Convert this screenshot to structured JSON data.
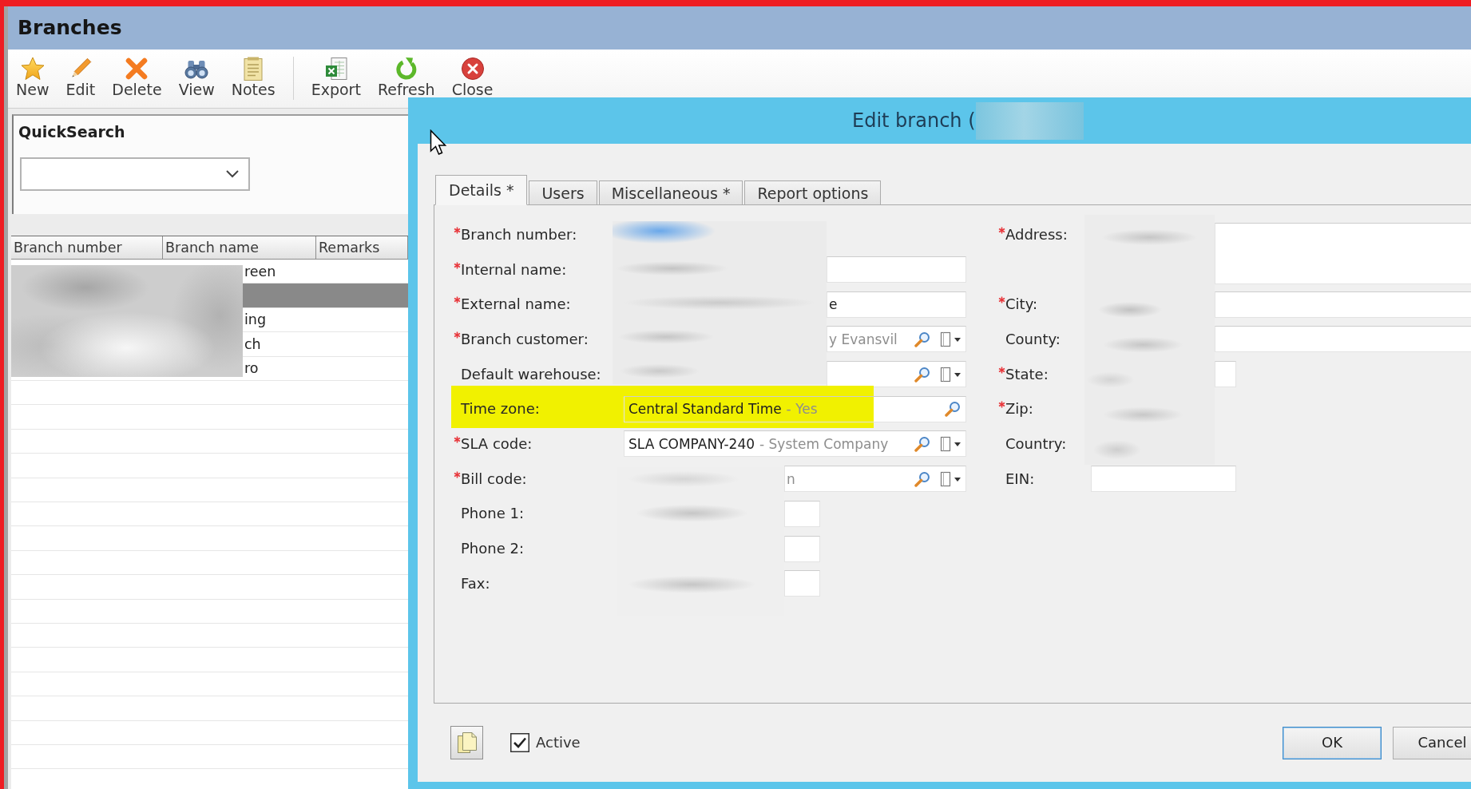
{
  "window": {
    "title": "Branches"
  },
  "toolbar": {
    "groups": [
      {
        "items": [
          {
            "label": "New"
          },
          {
            "label": "Edit"
          },
          {
            "label": "Delete"
          },
          {
            "label": "View"
          },
          {
            "label": "Notes"
          }
        ]
      },
      {
        "items": [
          {
            "label": "Export"
          },
          {
            "label": "Refresh"
          },
          {
            "label": "Close"
          }
        ]
      }
    ]
  },
  "quick_search": {
    "title": "QuickSearch"
  },
  "branch_list": {
    "columns": [
      "Branch number",
      "Branch name",
      "Remarks"
    ],
    "rows": [
      {
        "selected": false,
        "branch_name": "reen"
      },
      {
        "selected": true
      },
      {
        "selected": false,
        "branch_name": "ing"
      },
      {
        "selected": false,
        "branch_name": "ch"
      },
      {
        "selected": false,
        "branch_name": "ro"
      }
    ]
  },
  "dialog": {
    "title": "Edit branch (",
    "tabs": [
      {
        "label": "Details *",
        "selected": true
      },
      {
        "label": "Users",
        "selected": false
      },
      {
        "label": "Miscellaneous *",
        "selected": false
      },
      {
        "label": "Report options",
        "selected": false
      }
    ],
    "left_fields": [
      {
        "label": "Branch number:",
        "required": true,
        "kind": "none",
        "highlighted": false
      },
      {
        "label": "Internal name:",
        "required": true,
        "kind": "text",
        "highlighted": false
      },
      {
        "label": "External name:",
        "required": true,
        "kind": "text",
        "value": "e",
        "highlighted": false
      },
      {
        "label": "Branch customer:",
        "required": true,
        "kind": "lookup",
        "description": "y Evansvil",
        "highlighted": false
      },
      {
        "label": "Default warehouse:",
        "required": false,
        "kind": "lookup",
        "highlighted": false
      },
      {
        "label": "Time zone:",
        "required": false,
        "kind": "search",
        "value": "Central Standard Time",
        "description": "- Yes",
        "highlighted": true
      },
      {
        "label": "SLA code:",
        "required": true,
        "kind": "lookup",
        "value": "SLA COMPANY-240",
        "description": "- System Company",
        "highlighted": false
      },
      {
        "label": "Bill code:",
        "required": true,
        "kind": "lookup",
        "description": "n",
        "highlighted": false
      },
      {
        "label": "Phone 1:",
        "required": false,
        "kind": "short",
        "highlighted": false
      },
      {
        "label": "Phone 2:",
        "required": false,
        "kind": "short",
        "highlighted": false
      },
      {
        "label": "Fax:",
        "required": false,
        "kind": "short",
        "highlighted": false
      }
    ],
    "right_fields": [
      {
        "label": "Address:",
        "required": true,
        "kind": "textarea",
        "highlighted": false
      },
      {
        "label": "City:",
        "required": true,
        "kind": "text",
        "highlighted": false
      },
      {
        "label": "County:",
        "required": false,
        "kind": "text",
        "highlighted": false
      },
      {
        "label": "State:",
        "required": true,
        "kind": "short",
        "highlighted": false
      },
      {
        "label": "Zip:",
        "required": true,
        "kind": "none",
        "highlighted": false
      },
      {
        "label": "Country:",
        "required": false,
        "kind": "none",
        "highlighted": false
      },
      {
        "label": "EIN:",
        "required": false,
        "kind": "short",
        "highlighted": false
      }
    ],
    "active": {
      "label": "Active",
      "checked": true
    },
    "buttons": [
      {
        "label": "OK",
        "default": true
      },
      {
        "label": "Cancel",
        "default": false
      }
    ]
  }
}
